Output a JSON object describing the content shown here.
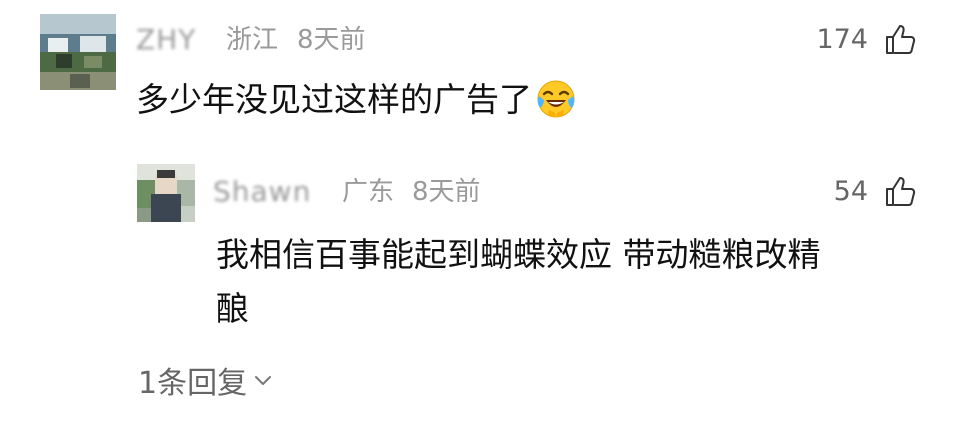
{
  "comment": {
    "author": "ZHY",
    "location": "浙江",
    "time": "8天前",
    "likes": "174",
    "text": "多少年没见过这样的广告了",
    "emoji": "crying-laughing-emoji"
  },
  "reply": {
    "author": "Shawn",
    "location": "广东",
    "time": "8天前",
    "likes": "54",
    "text_line1": "我相信百事能起到蝴蝶效应 带动糙粮改精",
    "text_line2": "酿"
  },
  "replies_toggle": {
    "label": "1条回复"
  },
  "colors": {
    "meta": "#9a9a9a",
    "text": "#111111",
    "muted": "#666666"
  }
}
